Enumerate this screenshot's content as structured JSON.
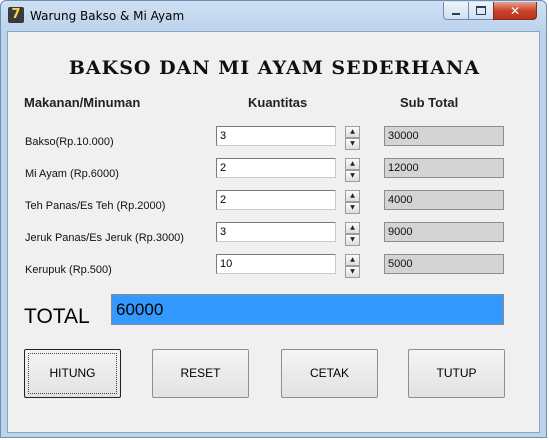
{
  "window": {
    "title": "Warung Bakso & Mi Ayam",
    "icon": "app-icon",
    "controls": [
      "minimize-icon",
      "maximize-icon",
      "close-icon"
    ]
  },
  "heading": "BAKSO DAN MI AYAM SEDERHANA",
  "columns": {
    "item": "Makanan/Minuman",
    "qty": "Kuantitas",
    "subtotal": "Sub Total"
  },
  "rows": [
    {
      "label": "Bakso(Rp.10.000)",
      "qty": "3",
      "subtotal": "30000"
    },
    {
      "label": "Mi Ayam (Rp.6000)",
      "qty": "2",
      "subtotal": "12000"
    },
    {
      "label": "Teh Panas/Es Teh (Rp.2000)",
      "qty": "2",
      "subtotal": "4000"
    },
    {
      "label": "Jeruk Panas/Es Jeruk (Rp.3000)",
      "qty": "3",
      "subtotal": "9000"
    },
    {
      "label": "Kerupuk (Rp.500)",
      "qty": "10",
      "subtotal": "5000"
    }
  ],
  "total": {
    "label": "TOTAL",
    "value": "60000",
    "color": "#3399ff"
  },
  "buttons": {
    "hitung": "HITUNG",
    "reset": "RESET",
    "cetak": "CETAK",
    "tutup": "TUTUP"
  }
}
